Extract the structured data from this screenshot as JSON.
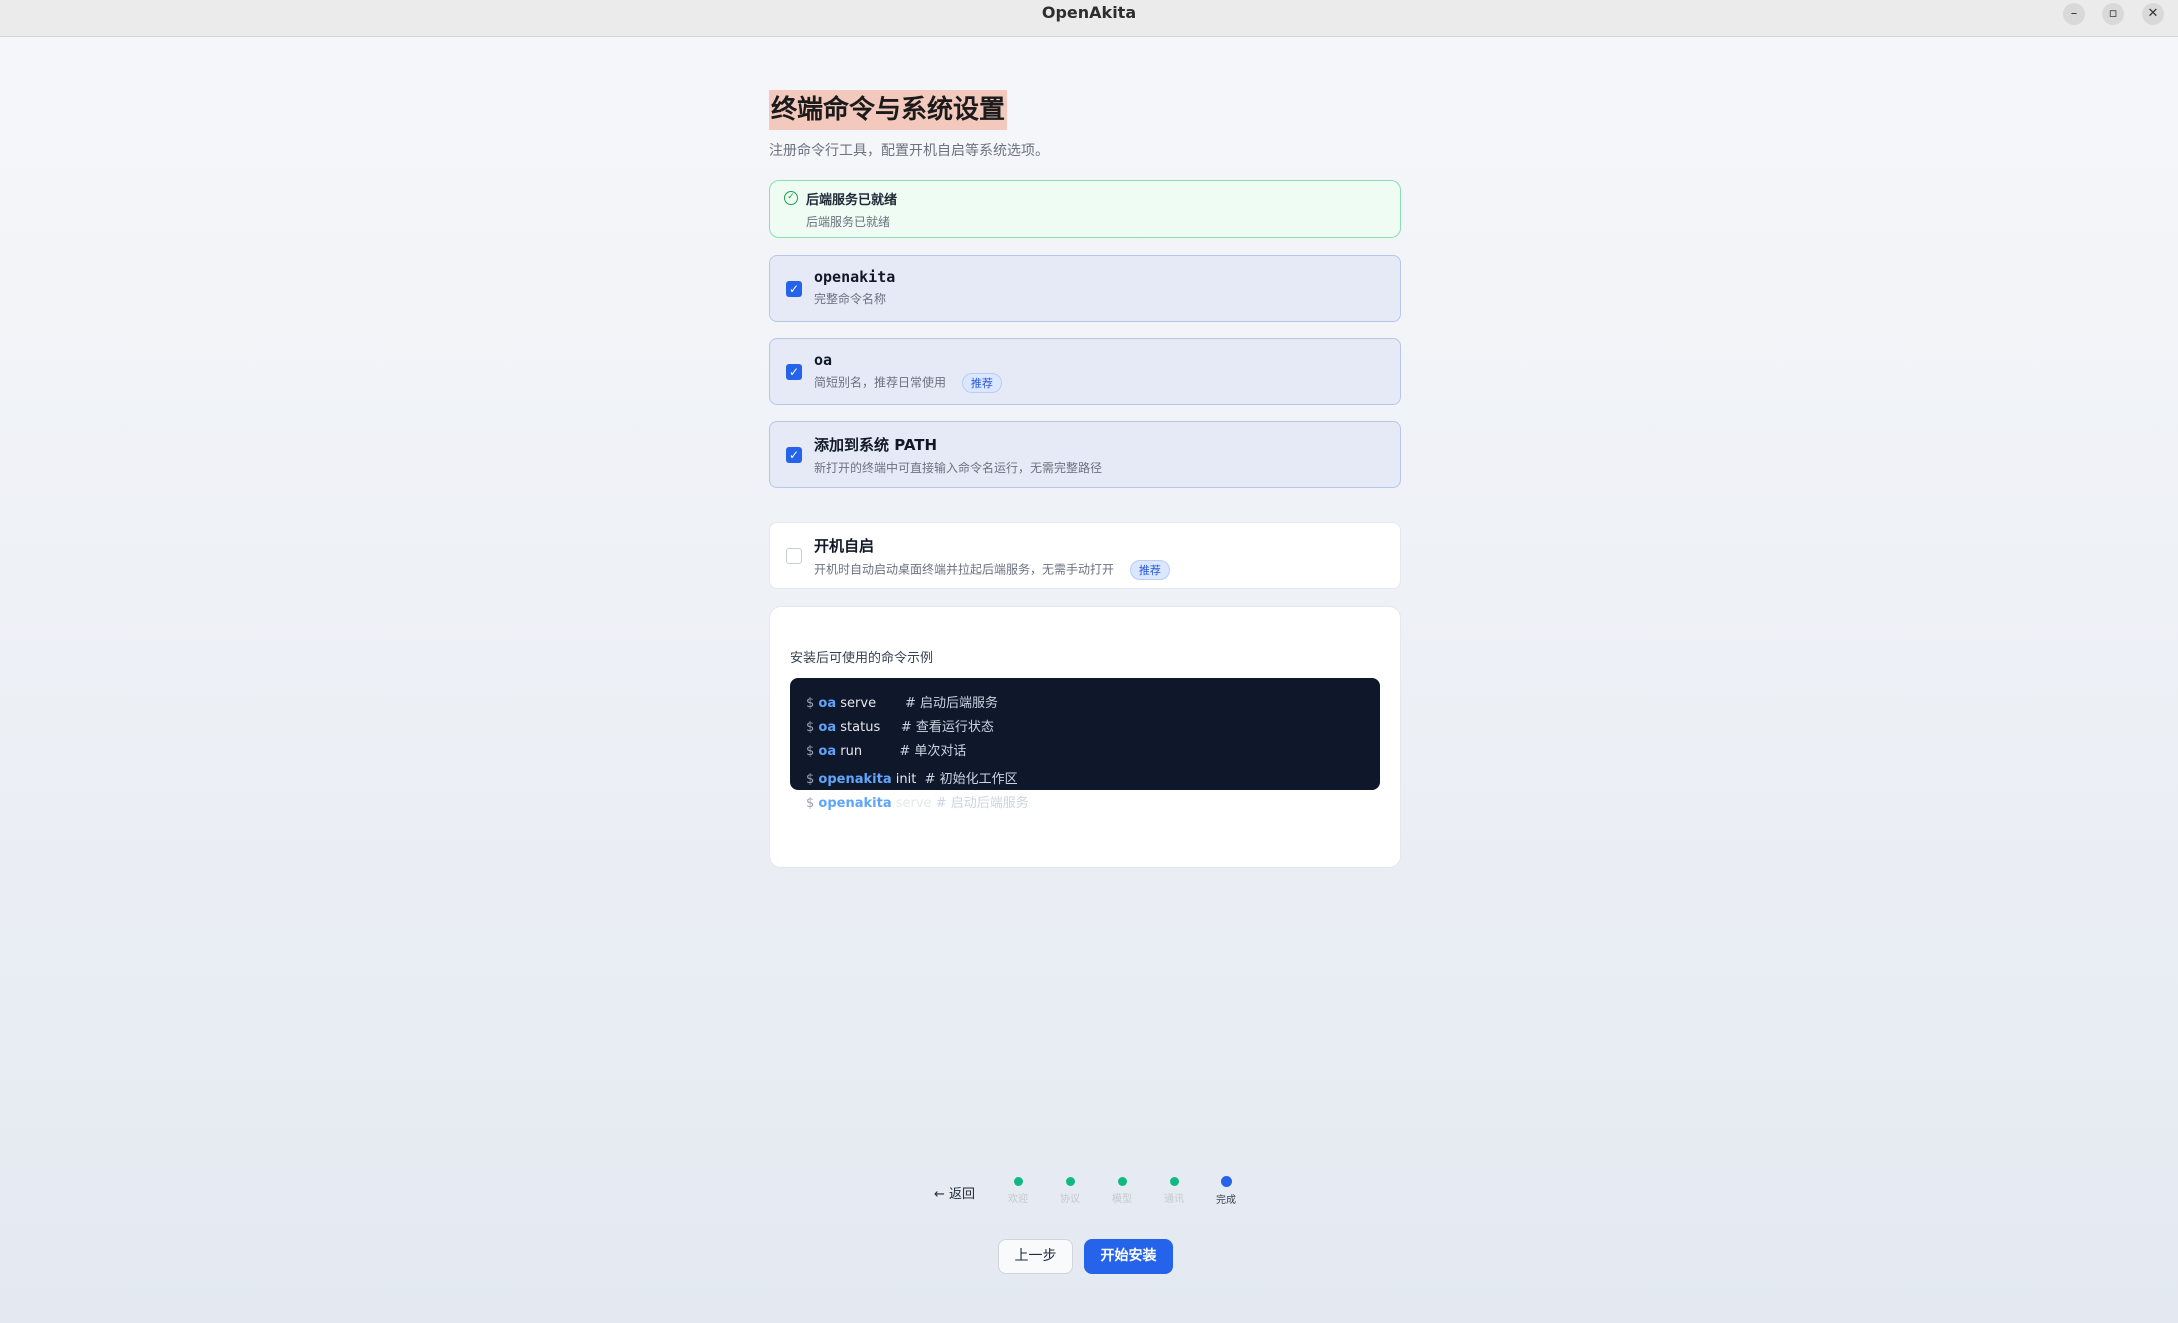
{
  "window": {
    "title": "OpenAkita",
    "minimize": "–",
    "restore": "▫",
    "close": "✕"
  },
  "page": {
    "title": "终端命令与系统设置",
    "subtitle": "注册命令行工具，配置开机自启等系统选项。"
  },
  "status": {
    "icon": "check-circle-icon",
    "title": "后端服务已就绪",
    "detail": "后端服务已就绪"
  },
  "options": [
    {
      "name": "openakita",
      "desc": "完整命令名称",
      "checked": true,
      "badge": ""
    },
    {
      "name": "oa",
      "desc": "简短别名，推荐日常使用",
      "checked": true,
      "badge": "推荐"
    },
    {
      "name": "添加到系统 PATH",
      "desc": "新打开的终端中可直接输入命令名运行，无需完整路径",
      "checked": true,
      "badge": ""
    }
  ],
  "autostart": {
    "name": "开机自启",
    "desc": "开机时自动启动桌面终端并拉起后端服务，无需手动打开",
    "checked": false,
    "badge": "推荐"
  },
  "examples": {
    "label": "安装后可使用的命令示例",
    "lines": [
      {
        "prompt": "$",
        "cmd": "oa",
        "arg": "serve",
        "comment": "# 启动后端服务"
      },
      {
        "prompt": "$",
        "cmd": "oa",
        "arg": "status",
        "comment": "# 查看运行状态"
      },
      {
        "prompt": "$",
        "cmd": "oa",
        "arg": "run",
        "comment": "# 单次对话"
      },
      {
        "prompt": "$",
        "cmd": "openakita",
        "arg": "init",
        "comment": "# 初始化工作区"
      },
      {
        "prompt": "$",
        "cmd": "openakita",
        "arg": "serve",
        "comment": "# 启动后端服务"
      }
    ]
  },
  "footer": {
    "back": "← 返回",
    "steps": [
      {
        "label": "欢迎",
        "state": "done"
      },
      {
        "label": "协议",
        "state": "done"
      },
      {
        "label": "模型",
        "state": "done"
      },
      {
        "label": "通讯",
        "state": "done"
      },
      {
        "label": "完成",
        "state": "active"
      }
    ],
    "prev": "上一步",
    "install": "开始安装"
  },
  "colors": {
    "accent": "#2563eb",
    "success": "#10b981",
    "code_bg": "#0f172a"
  }
}
